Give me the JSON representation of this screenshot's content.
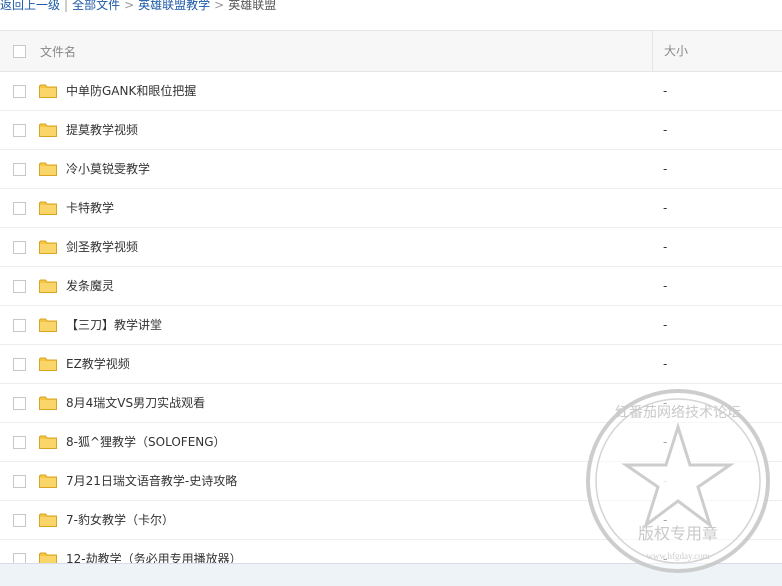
{
  "breadcrumb": {
    "back": "返回上一级",
    "all_files": "全部文件",
    "parent": "英雄联盟教学",
    "current": "英雄联盟"
  },
  "columns": {
    "name": "文件名",
    "size": "大小"
  },
  "files": [
    {
      "name": "中单防GANK和眼位把握",
      "size": "-"
    },
    {
      "name": "提莫教学视频",
      "size": "-"
    },
    {
      "name": "冷小莫锐雯教学",
      "size": "-"
    },
    {
      "name": "卡特教学",
      "size": "-"
    },
    {
      "name": "剑圣教学视频",
      "size": "-"
    },
    {
      "name": "发条魔灵",
      "size": "-"
    },
    {
      "name": "【三刀】教学讲堂",
      "size": "-"
    },
    {
      "name": "EZ教学视频",
      "size": "-"
    },
    {
      "name": "8月4瑞文VS男刀实战观看",
      "size": "-"
    },
    {
      "name": "8-狐^狸教学（SOLOFENG）",
      "size": "-"
    },
    {
      "name": "7月21日瑞文语音教学-史诗攻略",
      "size": "-"
    },
    {
      "name": "7-豹女教学（卡尔）",
      "size": "-"
    },
    {
      "name": "12-劫教学（务必用专用播放器）",
      "size": "-"
    }
  ],
  "stamp": {
    "arc_text": "红番茄网络技术论坛",
    "center_text": "版权专用章",
    "url": "www.hfgday.com"
  },
  "colors": {
    "link": "#1d5aa7",
    "folder": "#f6c443",
    "stamp": "#c8c8c8"
  }
}
